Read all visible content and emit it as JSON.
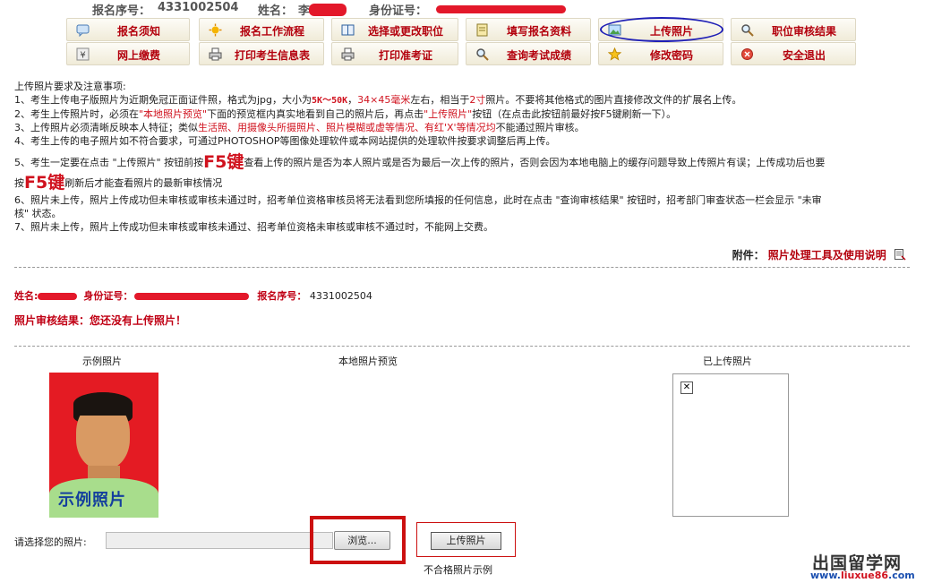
{
  "header": {
    "reg_no_label": "报名序号：",
    "reg_no": "4331002504",
    "name_label": "姓名：",
    "name_visible": "李",
    "id_label": "身份证号："
  },
  "nav": [
    {
      "label": "报名须知",
      "icon": "speech-bubble-icon",
      "interactable": true
    },
    {
      "label": "报名工作流程",
      "icon": "gear-sun-icon",
      "interactable": true
    },
    {
      "label": "选择或更改职位",
      "icon": "book-icon",
      "interactable": true
    },
    {
      "label": "填写报名资料",
      "icon": "notepad-icon",
      "interactable": true
    },
    {
      "label": "上传照片",
      "icon": "picture-icon",
      "interactable": true
    },
    {
      "label": "职位审核结果",
      "icon": "magnifier-icon",
      "interactable": true
    },
    {
      "label": "网上缴费",
      "icon": "yen-icon",
      "interactable": true
    },
    {
      "label": "打印考生信息表",
      "icon": "printer-icon",
      "interactable": true
    },
    {
      "label": "打印准考证",
      "icon": "printer-icon",
      "interactable": true
    },
    {
      "label": "查询考试成绩",
      "icon": "magnifier-icon",
      "interactable": true
    },
    {
      "label": "修改密码",
      "icon": "star-icon",
      "interactable": true
    },
    {
      "label": "安全退出",
      "icon": "exit-icon",
      "interactable": true
    }
  ],
  "notice": {
    "title": "上传照片要求及注意事项:",
    "l1_a": "1、考生上传电子版照片为近期免冠正面证件照，格式为jpg，大小为",
    "l1_size": "5K～50K",
    "l1_b": "，",
    "l1_dim": "34×45毫米",
    "l1_c": "左右，相当于",
    "l1_inch": "2寸",
    "l1_d": "照片。不要将其他格式的图片直接修改文件的扩展名上传。",
    "l2_a": "2、考生上传照片时，必须在",
    "l2_b": "\"本地照片预览\"",
    "l2_c": "下面的预览框内真实地看到自己的照片后，再点击",
    "l2_d": "\"上传照片\"",
    "l2_e": "按钮（在点击此按钮前最好按F5键刷新一下）。",
    "l3_a": "3、上传照片必须清晰反映本人特征；类似",
    "l3_b": "生活照、用摄像头所摄照片、照片模糊或虚等情况、有红'X'等情况均",
    "l3_c": "不能通过照片审核。",
    "l4": "4、考生上传的电子照片如不符合要求，可通过PHOTOSHOP等图像处理软件或本网站提供的处理软件按要求调整后再上传。",
    "l5_a": "5、考生一定要在点击 \"上传照片\" 按钮前按",
    "l5_f5": "F5键",
    "l5_b": "查看上传的照片是否为本人照片或是否为最后一次上传的照片，否则会因为本地电脑上的缓存问题导致上传照片有误；上传成功后也要",
    "l5_c": "按",
    "l5_f5b": "F5键",
    "l5_d": "刷新后才能查看照片的最新审核情况",
    "l6a": "6、照片未上传，照片上传成功但未审核或审核未通过时，招考单位资格审核员将无法看到您所填报的任何信息，此时在点击 \"查询审核结果\" 按钮时，招考部门审查状态一栏会显示 \"未审",
    "l6b": "核\" 状态。",
    "l7": "7、照片未上传，照片上传成功但未审核或审核未通过、招考单位资格未审核或审核不通过时，不能网上交费。"
  },
  "attachment": {
    "label": "附件：",
    "link": "照片处理工具及使用说明"
  },
  "info": {
    "name_label": "姓名:",
    "id_label": "身份证号：",
    "reg_label": "报名序号：",
    "reg_no": "4331002504"
  },
  "result": "照片审核结果：您还没有上传照片！",
  "columns": {
    "sample": "示例照片",
    "preview": "本地照片预览",
    "uploaded": "已上传照片"
  },
  "sample_caption": "示例照片",
  "upload": {
    "choose_label": "请选择您的照片:",
    "browse": "浏览...",
    "upload_button": "上传照片",
    "bad_example": "不合格照片示例"
  },
  "watermark": {
    "site_cn": "出国留学网",
    "site_a": "www.",
    "site_b": "liuxue86",
    "site_c": ".com"
  }
}
